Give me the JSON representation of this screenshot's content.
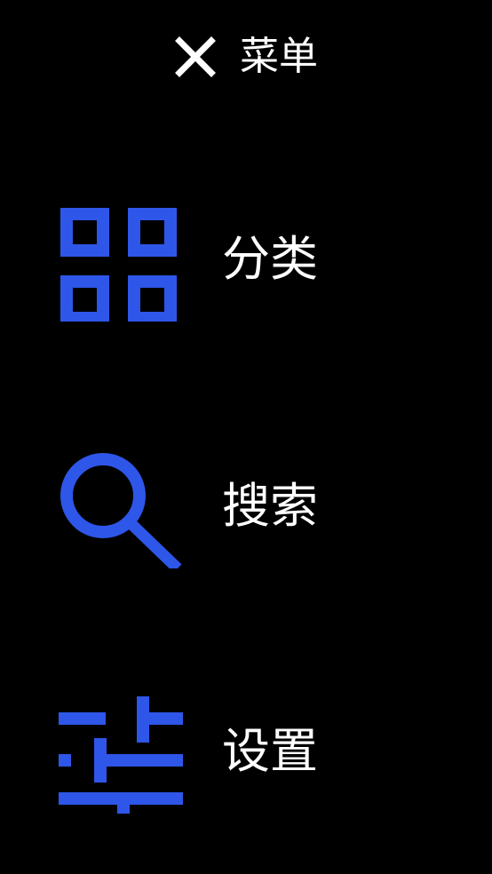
{
  "theme": {
    "background": "#000000",
    "accent": "#2e56e8",
    "text": "#ffffff"
  },
  "header": {
    "close_icon": "close-icon",
    "title": "菜单"
  },
  "menu": {
    "items": [
      {
        "icon": "grid-icon",
        "label": "分类"
      },
      {
        "icon": "search-icon",
        "label": "搜索"
      },
      {
        "icon": "sliders-icon",
        "label": "设置"
      }
    ]
  }
}
